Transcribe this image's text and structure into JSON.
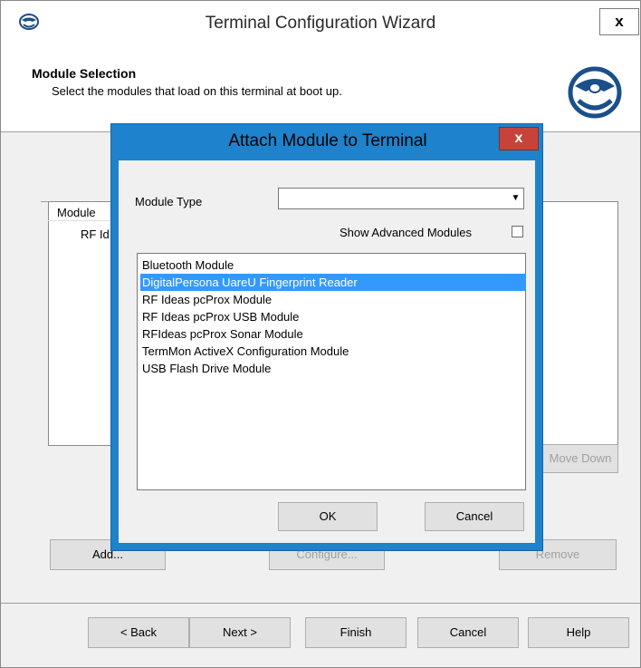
{
  "wizard": {
    "title": "Terminal Configuration Wizard",
    "close_label": "x",
    "header_title": "Module Selection",
    "header_subtitle": "Select the modules that load on this terminal at boot up.",
    "module_list": {
      "column_header": "Module",
      "rows": [
        "RF Id"
      ]
    },
    "buttons": {
      "move_down": "Move Down",
      "add": "Add...",
      "configure": "Configure...",
      "remove": "Remove",
      "back": "< Back",
      "next": "Next >",
      "finish": "Finish",
      "cancel": "Cancel",
      "help": "Help"
    }
  },
  "modal": {
    "title": "Attach Module to Terminal",
    "close_label": "x",
    "module_type_label": "Module Type",
    "module_type_value": "",
    "show_advanced_label": "Show Advanced Modules",
    "show_advanced_checked": false,
    "modules": [
      "Bluetooth Module",
      "DigitalPersona UareU Fingerprint Reader",
      "RF Ideas pcProx Module",
      "RF Ideas pcProx USB Module",
      "RFIdeas pcProx Sonar Module",
      "TermMon ActiveX Configuration Module",
      "USB Flash Drive Module"
    ],
    "selected_module": "DigitalPersona UareU Fingerprint Reader",
    "ok_label": "OK",
    "cancel_label": "Cancel"
  },
  "colors": {
    "modal_frame": "#1e82cc",
    "modal_close": "#c7433a",
    "selection": "#3399ff"
  },
  "icons": {
    "app_icon": "terminal-logo-icon",
    "header_logo": "thinmanager-logo-icon",
    "dropdown": "chevron-down-icon"
  }
}
